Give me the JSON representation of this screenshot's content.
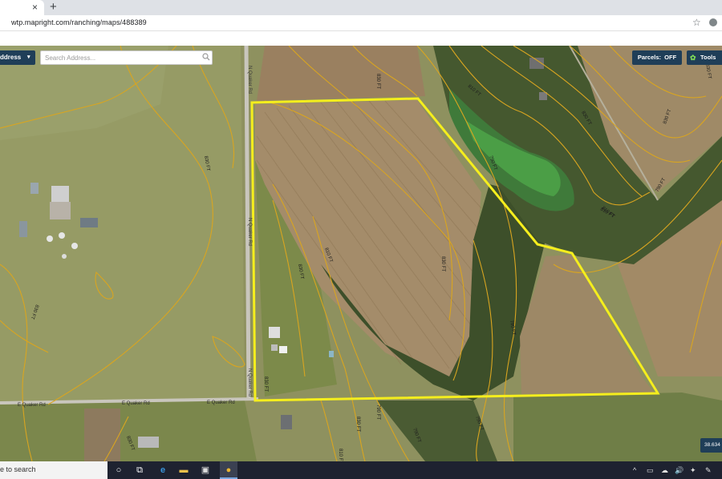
{
  "browser": {
    "tab_close": "×",
    "new_tab": "+",
    "url": "wtp.mapright.com/ranching/maps/488389",
    "star_icon": "☆"
  },
  "map_controls": {
    "address_button": "ddress",
    "address_chevron": "▾",
    "search_placeholder": "Search Address...",
    "parcels_label": "Parcels:",
    "parcels_value": "OFF",
    "tools_label": "Tools",
    "gear_icon": "✿",
    "coord_text": "38.634"
  },
  "contour_labels": [
    {
      "text": "830 FT"
    },
    {
      "text": "830 FT"
    },
    {
      "text": "830 FT"
    },
    {
      "text": "830 FT"
    },
    {
      "text": "830 FT"
    },
    {
      "text": "810 FT"
    },
    {
      "text": "810 FT"
    },
    {
      "text": "790 FT"
    },
    {
      "text": "790 FT"
    },
    {
      "text": "810 FT"
    },
    {
      "text": "790 FT"
    },
    {
      "text": "830 FT"
    },
    {
      "text": "830 FT"
    },
    {
      "text": "830 FT"
    },
    {
      "text": "810 FT"
    },
    {
      "text": "790 FT"
    },
    {
      "text": "790 FT"
    },
    {
      "text": "830 FT"
    },
    {
      "text": "830 FT"
    },
    {
      "text": "790 FT"
    },
    {
      "text": "830 FT"
    },
    {
      "text": "810 FT"
    }
  ],
  "road_labels": {
    "quaker_rd_n_top": "N Quaker Rd",
    "quaker_rd_n_mid": "N Quaker Rd",
    "quaker_rd_n_bottom": "N Quaker Rd",
    "e_quaker_left": "E Quaker Rd",
    "e_quaker_mid": "E Quaker Rd",
    "e_quaker_right": "E Quaker Rd"
  },
  "taskbar": {
    "search_text": "e to search",
    "cortana_icon": "○",
    "taskview_icon": "⧉",
    "edge_icon": "e",
    "folder_icon": "▬",
    "store_icon": "▣",
    "chrome_icon": "●",
    "tray_up": "^",
    "tray_icons": [
      "▭",
      "☁",
      "🔊",
      "✦",
      "✎"
    ]
  },
  "colors": {
    "boundary": "#f5ee1d",
    "contour": "#d9a520",
    "control_bg": "#1f3e58"
  }
}
